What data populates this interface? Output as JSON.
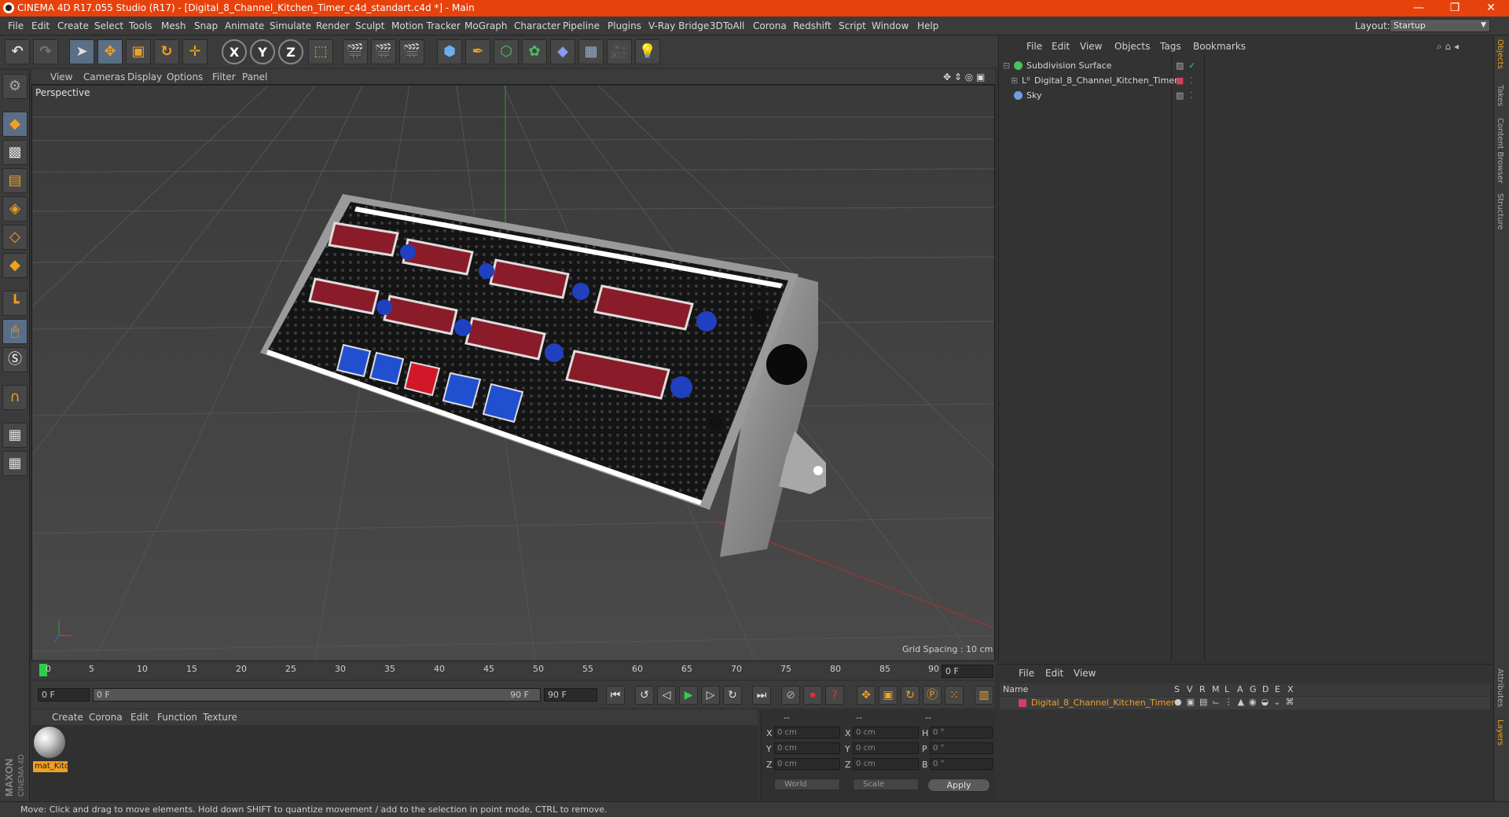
{
  "window": {
    "title": "CINEMA 4D R17.055 Studio (R17) - [Digital_8_Channel_Kitchen_Timer_c4d_standart.c4d *] - Main",
    "min": "—",
    "max": "❐",
    "close": "✕"
  },
  "menu": [
    "File",
    "Edit",
    "Create",
    "Select",
    "Tools",
    "Mesh",
    "Snap",
    "Animate",
    "Simulate",
    "Render",
    "Sculpt",
    "Motion Tracker",
    "MoGraph",
    "Character",
    "Pipeline",
    "Plugins",
    "V-Ray Bridge",
    "3DToAll",
    "Corona",
    "Redshift",
    "Script",
    "Window",
    "Help"
  ],
  "layout": {
    "label": "Layout:",
    "value": "Startup"
  },
  "viewport": {
    "menu": [
      "View",
      "Cameras",
      "Display",
      "Options",
      "Filter",
      "Panel"
    ],
    "camera_label": "Perspective",
    "grid_spacing": "Grid Spacing : 10 cm"
  },
  "timeline": {
    "ticks": [
      "0",
      "5",
      "10",
      "15",
      "20",
      "25",
      "30",
      "35",
      "40",
      "45",
      "50",
      "55",
      "60",
      "65",
      "70",
      "75",
      "80",
      "85",
      "90"
    ],
    "current_frame": "0 F",
    "start_field": "0 F",
    "range_start": "0 F",
    "range_end": "90 F",
    "end_field": "90 F"
  },
  "materials": {
    "menu": [
      "Create",
      "Corona",
      "Edit",
      "Function",
      "Texture"
    ],
    "items": [
      {
        "name": "mat_Kitc"
      }
    ]
  },
  "coordinates": {
    "headers": [
      "--",
      "--",
      "--"
    ],
    "rows": [
      {
        "a": "X",
        "av": "0 cm",
        "b": "X",
        "bv": "0 cm",
        "c": "H",
        "cv": "0 °"
      },
      {
        "a": "Y",
        "av": "0 cm",
        "b": "Y",
        "bv": "0 cm",
        "c": "P",
        "cv": "0 °"
      },
      {
        "a": "Z",
        "av": "0 cm",
        "b": "Z",
        "bv": "0 cm",
        "c": "B",
        "cv": "0 °"
      }
    ],
    "mode1": "World",
    "mode2": "Scale",
    "apply": "Apply"
  },
  "objects": {
    "menu": [
      "File",
      "Edit",
      "View",
      "Objects",
      "Tags",
      "Bookmarks"
    ],
    "items": [
      {
        "name": "Subdivision Surface",
        "icon_color": "#4ac060"
      },
      {
        "name": "Digital_8_Channel_Kitchen_Timer",
        "icon_color": "#d0d0d0"
      },
      {
        "name": "Sky",
        "icon_color": "#6aa0e0"
      }
    ]
  },
  "layers": {
    "menu": [
      "File",
      "Edit",
      "View"
    ],
    "header": {
      "name": "Name",
      "cols": [
        "S",
        "V",
        "R",
        "M",
        "L",
        "A",
        "G",
        "D",
        "E",
        "X"
      ]
    },
    "items": [
      {
        "name": "Digital_8_Channel_Kitchen_Timer",
        "color": "#d04060"
      }
    ]
  },
  "right_tabs": [
    "Objects",
    "Takes",
    "Content Browser",
    "Structure",
    "Attributes",
    "Layers"
  ],
  "status": "Move: Click and drag to move elements. Hold down SHIFT to quantize movement / add to the selection in point mode, CTRL to remove.",
  "logo": {
    "line1": "MAXON",
    "line2": "CINEMA 4D"
  },
  "accent": "#f0a020",
  "titlebar_color": "#e8420c"
}
